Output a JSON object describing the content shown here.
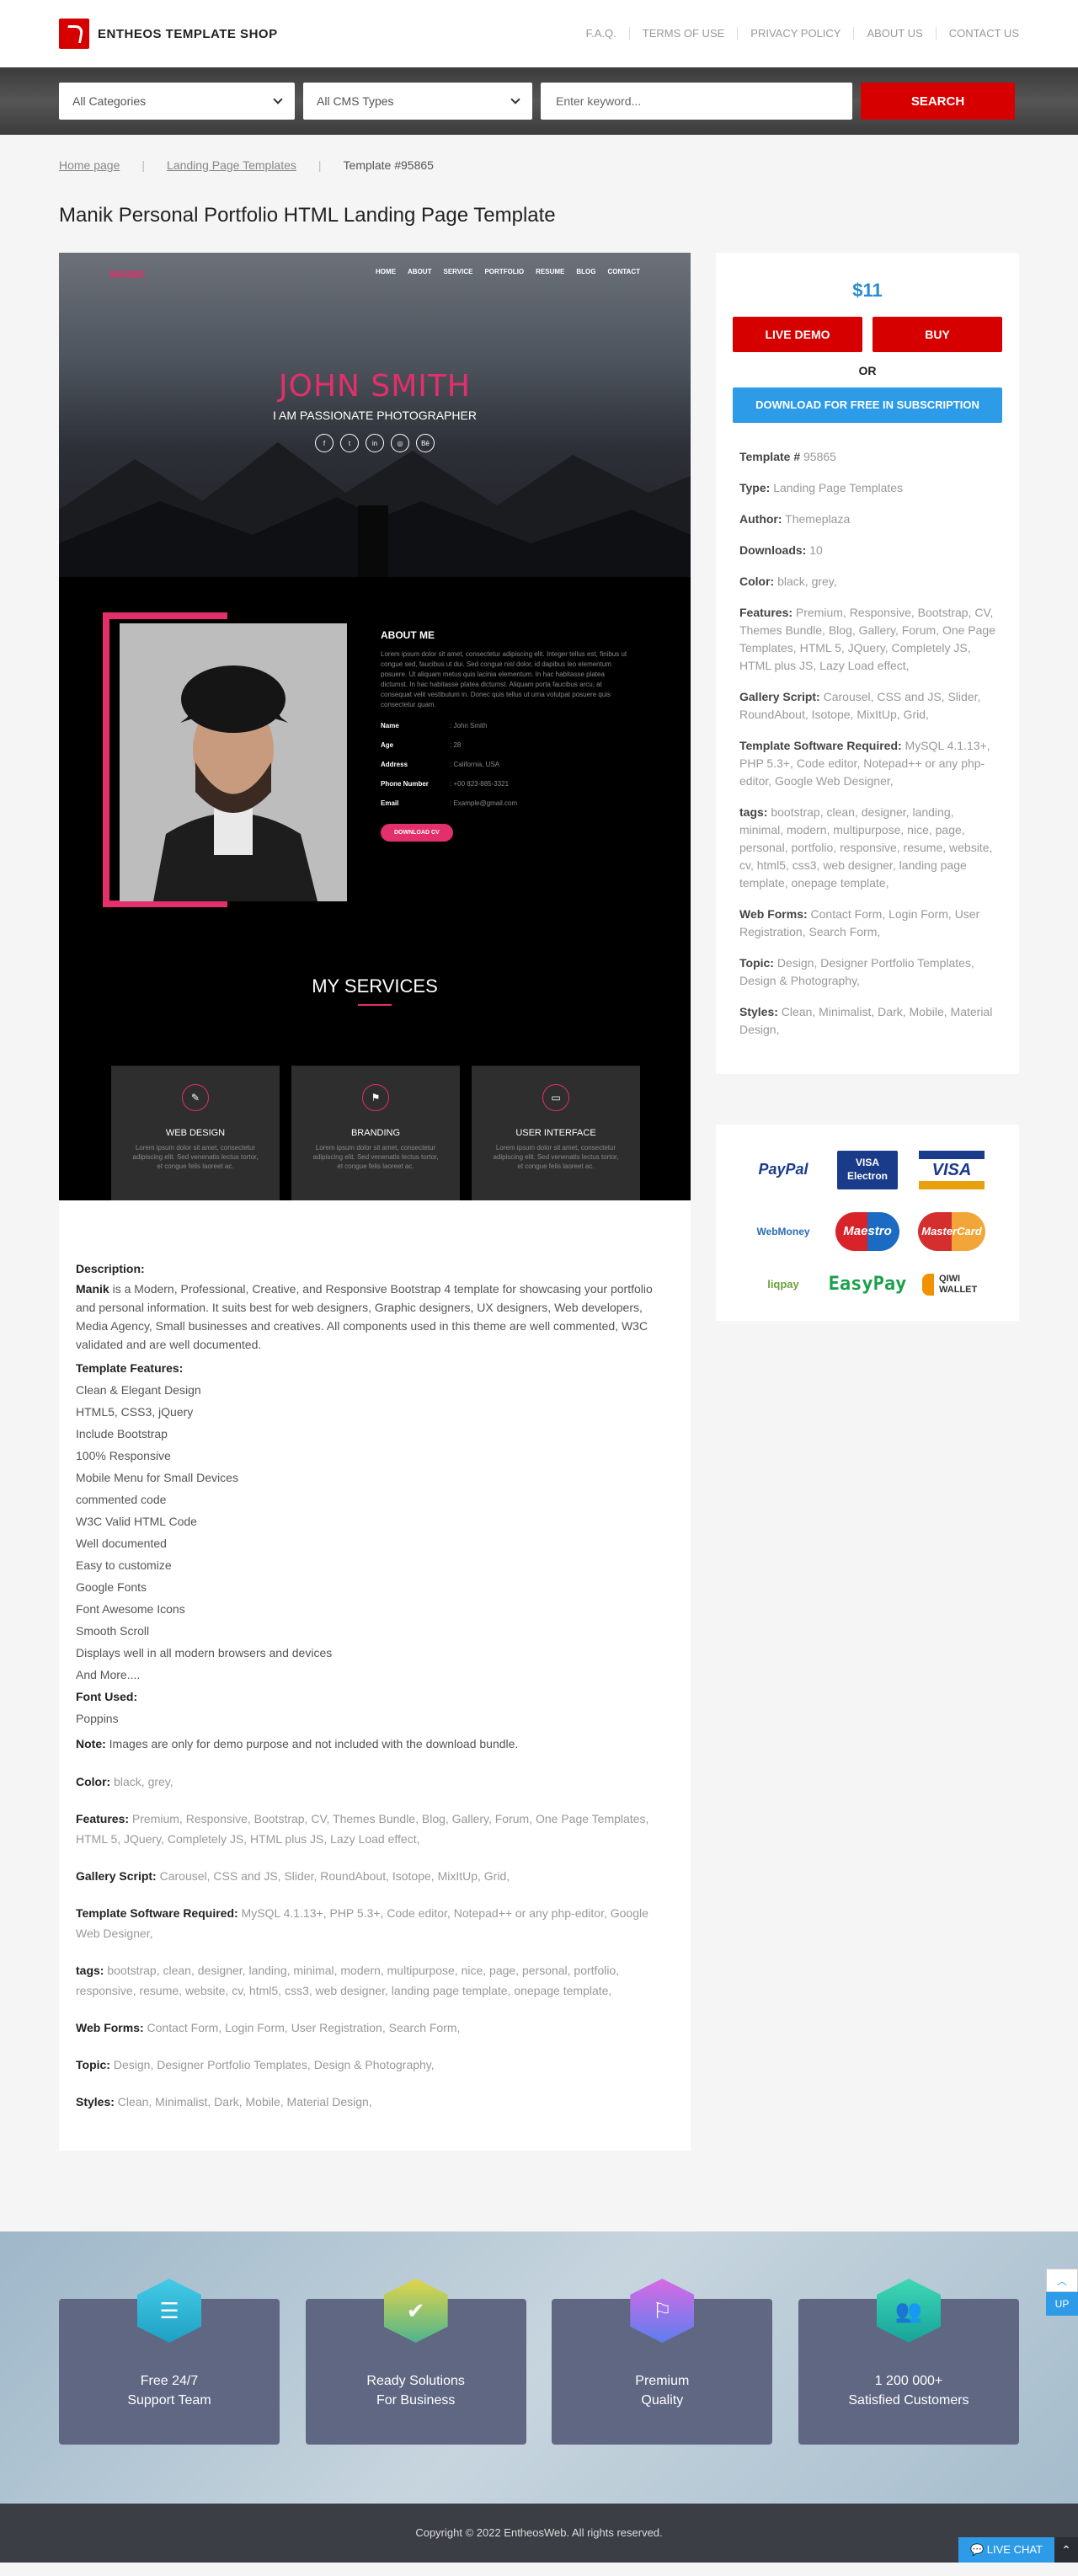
{
  "header": {
    "logo_text": "ENTHEOS TEMPLATE SHOP",
    "nav": [
      "F.A.Q.",
      "TERMS OF USE",
      "PRIVACY POLICY",
      "ABOUT US",
      "CONTACT US"
    ]
  },
  "search": {
    "category": "All Categories",
    "cms": "All CMS Types",
    "placeholder": "Enter keyword...",
    "button": "SEARCH"
  },
  "breadcrumb": {
    "home": "Home page",
    "section": "Landing Page Templates",
    "current": "Template #95865"
  },
  "title": "Manik Personal Portfolio HTML Landing Page Template",
  "preview": {
    "brand": "MANIK",
    "menu": [
      "HOME",
      "ABOUT",
      "SERVICE",
      "PORTFOLIO",
      "RESUME",
      "BLOG",
      "CONTACT"
    ],
    "name": "JOHN SMITH",
    "tagline": "I AM PASSIONATE PHOTOGRAPHER",
    "about_title": "ABOUT ME",
    "about_lorem": "Lorem ipsum dolor sit amet, consectetur adipiscing elit. Integer tellus est, finibus ut congue sed, faucibus ut dui. Sed congue nisl dolor, id dapibus leo elementum posuere. Ut aliquam metus quis lacinia elementum. In hac habitasse platea dictumst. In hac habitasse platea dictumst. Aliquam porta faucibus arcu, at consequat velit vestibulum in. Donec quis tellus ut urna volutpat posuere quis consectetur quam.",
    "info": [
      {
        "k": "Name",
        "v": ": John Smith"
      },
      {
        "k": "Age",
        "v": ": 28"
      },
      {
        "k": "Address",
        "v": ": California, USA"
      },
      {
        "k": "Phone Number",
        "v": ": +00 823-885-3321"
      },
      {
        "k": "Email",
        "v": ": Example@gmail.com"
      }
    ],
    "cv_button": "DOWNLOAD CV",
    "services_title": "MY SERVICES",
    "services": [
      {
        "name": "WEB DESIGN",
        "text": "Lorem ipsum dolor sit amet, consectetur adipiscing elit. Sed venenatis lectus tortor, et congue felis laoreet ac."
      },
      {
        "name": "BRANDING",
        "text": "Lorem ipsum dolor sit amet, consectetur adipiscing elit. Sed venenatis lectus tortor, et congue felis laoreet ac."
      },
      {
        "name": "USER INTERFACE",
        "text": "Lorem ipsum dolor sit amet, consectetur adipiscing elit. Sed venenatis lectus tortor, et congue felis laoreet ac."
      }
    ]
  },
  "description": {
    "label": "Description:",
    "brand": "Manik",
    "text": " is a Modern, Professional, Creative, and Responsive Bootstrap 4 template for showcasing your portfolio and personal information. It suits best for web designers, Graphic designers, UX designers, Web developers, Media Agency, Small businesses and creatives. All components used in this theme are well commented, W3C validated and are well documented.",
    "features_label": "Template Features:",
    "features": [
      "Clean & Elegant Design",
      "HTML5, CSS3, jQuery",
      "Include Bootstrap",
      "100% Responsive",
      "Mobile Menu for Small Devices",
      "commented code",
      "W3C Valid HTML Code",
      "Well documented",
      "Easy to customize",
      "Google Fonts",
      "Font Awesome Icons",
      "Smooth Scroll",
      "Displays well in all modern browsers and devices",
      "And More...."
    ],
    "font_label": "Font Used:",
    "font": "Poppins",
    "note_label": "Note:",
    "note": " Images are only for demo purpose and not included with the download bundle.",
    "props": [
      {
        "k": "Color:",
        "v": " black, grey,"
      },
      {
        "k": "Features:",
        "v": " Premium, Responsive, Bootstrap, CV, Themes Bundle, Blog, Gallery, Forum, One Page Templates, HTML 5, JQuery, Completely JS, HTML plus JS, Lazy Load effect,"
      },
      {
        "k": "Gallery Script:",
        "v": " Carousel, CSS and JS, Slider, RoundAbout, Isotope, MixItUp, Grid,"
      },
      {
        "k": "Template Software Required:",
        "v": " MySQL 4.1.13+, PHP 5.3+, Code editor, Notepad++ or any php-editor, Google Web Designer,"
      },
      {
        "k": "tags:",
        "v": " bootstrap, clean, designer, landing, minimal, modern, multipurpose, nice, page, personal, portfolio, responsive, resume, website, cv, html5, css3, web designer, landing page template, onepage template,"
      },
      {
        "k": "Web Forms:",
        "v": " Contact Form, Login Form, User Registration, Search Form,"
      },
      {
        "k": "Topic:",
        "v": " Design, Designer Portfolio Templates, Design & Photography,"
      },
      {
        "k": "Styles:",
        "v": " Clean, Minimalist, Dark, Mobile, Material Design,"
      }
    ]
  },
  "sidebar": {
    "price": "$11",
    "live_demo": "LIVE DEMO",
    "buy": "BUY",
    "or": "OR",
    "download": "DOWNLOAD FOR FREE IN SUBSCRIPTION",
    "meta": [
      {
        "k": "Template #",
        "v": " 95865"
      },
      {
        "k": "Type:",
        "v": " Landing Page Templates"
      },
      {
        "k": "Author:",
        "v": " Themeplaza"
      },
      {
        "k": "Downloads:",
        "v": " 10"
      },
      {
        "k": "Color:",
        "v": " black, grey,"
      },
      {
        "k": "Features:",
        "v": " Premium, Responsive, Bootstrap, CV, Themes Bundle, Blog, Gallery, Forum, One Page Templates, HTML 5, JQuery, Completely JS, HTML plus JS, Lazy Load effect,"
      },
      {
        "k": "Gallery Script:",
        "v": " Carousel, CSS and JS, Slider, RoundAbout, Isotope, MixItUp, Grid,"
      },
      {
        "k": "Template Software Required:",
        "v": " MySQL 4.1.13+, PHP 5.3+, Code editor, Notepad++ or any php-editor, Google Web Designer,"
      },
      {
        "k": "tags:",
        "v": " bootstrap, clean, designer, landing, minimal, modern, multipurpose, nice, page, personal, portfolio, responsive, resume, website, cv, html5, css3, web designer, landing page template, onepage template,"
      },
      {
        "k": "Web Forms:",
        "v": " Contact Form, Login Form, User Registration, Search Form,"
      },
      {
        "k": "Topic:",
        "v": " Design, Designer Portfolio Templates, Design & Photography,"
      },
      {
        "k": "Styles:",
        "v": " Clean, Minimalist, Dark, Mobile, Material Design,"
      }
    ],
    "payments": [
      "PayPal",
      "VISA Electron",
      "VISA",
      "WebMoney",
      "Maestro",
      "MasterCard",
      "liqpay",
      "EasyPay",
      "QIWI WALLET"
    ]
  },
  "features_band": [
    {
      "line1": "Free 24/7",
      "line2": "Support Team",
      "icon": "chat-icon",
      "color": "#2bb7d6"
    },
    {
      "line1": "Ready Solutions",
      "line2": "For Business",
      "icon": "check-icon",
      "color": "#6cc070"
    },
    {
      "line1": "Premium",
      "line2": "Quality",
      "icon": "flag-icon",
      "color": "#7a6be0"
    },
    {
      "line1": "1 200 000+",
      "line2": "Satisfied Customers",
      "icon": "users-icon",
      "color": "#22b8a6"
    }
  ],
  "footer": {
    "copyright": "Copyright © 2022 EntheosWeb. All rights reserved.",
    "live_chat": "LIVE CHAT",
    "up": "UP"
  },
  "colors": {
    "brand_red": "#d60000",
    "accent_blue": "#2e9be9",
    "preview_pink": "#e32f6c"
  }
}
